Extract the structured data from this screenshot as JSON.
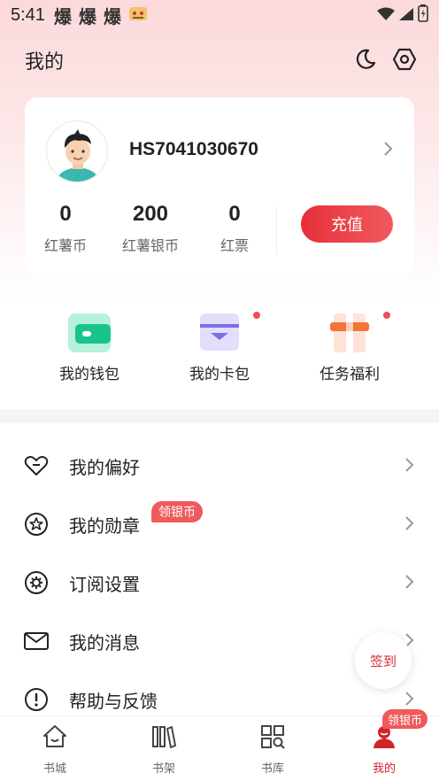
{
  "status_bar": {
    "time": "5:41",
    "app_icons": [
      "爆",
      "爆",
      "爆"
    ]
  },
  "header": {
    "title": "我的",
    "moon_icon": "moon-icon",
    "settings_icon": "hexagon-settings-icon"
  },
  "profile": {
    "username": "HS7041030670",
    "stats": [
      {
        "value": "0",
        "label": "红薯币"
      },
      {
        "value": "200",
        "label": "红薯银币"
      },
      {
        "value": "0",
        "label": "红票"
      }
    ],
    "recharge_label": "充值"
  },
  "quick_actions": [
    {
      "label": "我的钱包",
      "icon": "wallet-icon",
      "dot": false
    },
    {
      "label": "我的卡包",
      "icon": "card-pack-icon",
      "dot": true
    },
    {
      "label": "任务福利",
      "icon": "gift-icon",
      "dot": true
    }
  ],
  "menu": [
    {
      "label": "我的偏好",
      "icon": "heart-icon"
    },
    {
      "label": "我的勋章",
      "icon": "medal-icon",
      "badge": "领银币"
    },
    {
      "label": "订阅设置",
      "icon": "gear-icon"
    },
    {
      "label": "我的消息",
      "icon": "mail-icon"
    },
    {
      "label": "帮助与反馈",
      "icon": "help-icon"
    }
  ],
  "checkin_label": "签到",
  "bottom_nav": {
    "items": [
      {
        "label": "书城",
        "icon": "home-icon"
      },
      {
        "label": "书架",
        "icon": "bookshelf-icon"
      },
      {
        "label": "书库",
        "icon": "library-grid-icon"
      },
      {
        "label": "我的",
        "icon": "profile-icon",
        "active": true
      }
    ],
    "badge": "领银币"
  },
  "colors": {
    "accent_red": "#e6303a",
    "badge_red": "#ef5a5c",
    "wallet_green": "#1ec28b",
    "card_purple": "#7b6fe6",
    "gift_orange": "#f4733a"
  }
}
